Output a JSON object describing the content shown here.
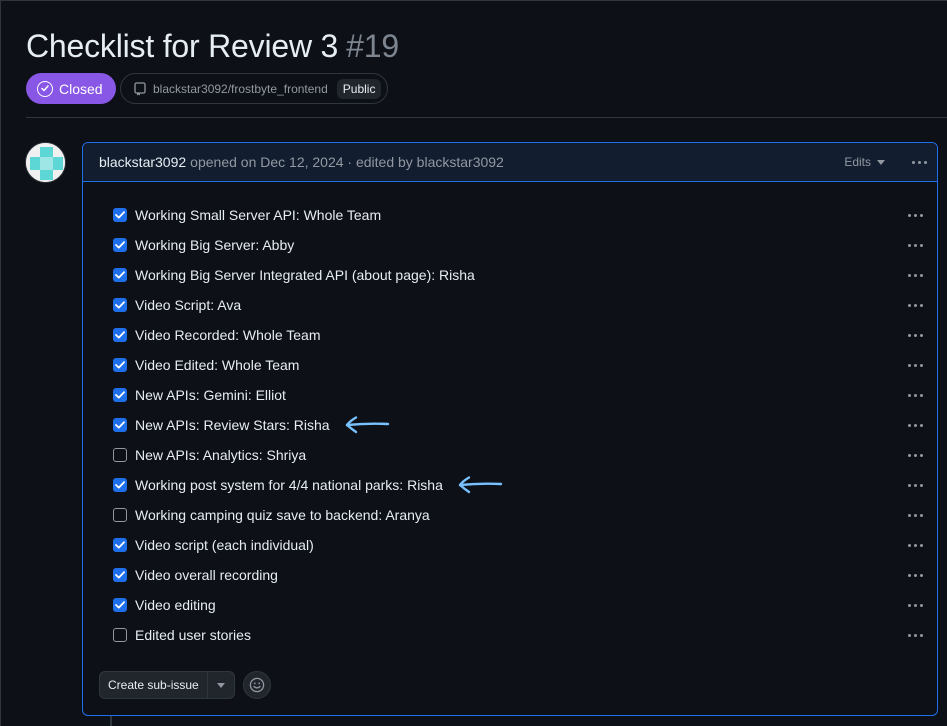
{
  "issue": {
    "title": "Checklist for Review 3",
    "number": "#19",
    "state": "Closed",
    "repo": "blackstar3092/frostbyte_frontend",
    "visibility": "Public"
  },
  "comment": {
    "author": "blackstar3092",
    "meta": "opened on Dec 12, 2024 · edited by blackstar3092",
    "edits_label": "Edits"
  },
  "tasks": [
    {
      "label": "Working Small Server API: Whole Team",
      "checked": true
    },
    {
      "label": "Working Big Server: Abby",
      "checked": true
    },
    {
      "label": "Working Big Server Integrated API (about page): Risha",
      "checked": true
    },
    {
      "label": "Video Script: Ava",
      "checked": true
    },
    {
      "label": "Video Recorded: Whole Team",
      "checked": true
    },
    {
      "label": "Video Edited: Whole Team",
      "checked": true
    },
    {
      "label": "New APIs: Gemini: Elliot",
      "checked": true
    },
    {
      "label": "New APIs: Review Stars: Risha",
      "checked": true,
      "annotated": true
    },
    {
      "label": "New APIs: Analytics: Shriya",
      "checked": false
    },
    {
      "label": "Working post system for 4/4 national parks: Risha",
      "checked": true,
      "annotated": true
    },
    {
      "label": "Working camping quiz save to backend: Aranya",
      "checked": false
    },
    {
      "label": "Video script (each individual)",
      "checked": true
    },
    {
      "label": "Video overall recording",
      "checked": true
    },
    {
      "label": "Video editing",
      "checked": true
    },
    {
      "label": "Edited user stories",
      "checked": false
    }
  ],
  "footer": {
    "create_sub_issue_label": "Create sub-issue"
  },
  "colors": {
    "closed_badge": "#8957e5",
    "checkbox_checked": "#1f6feb",
    "annotation_arrow": "#79c0ff"
  }
}
